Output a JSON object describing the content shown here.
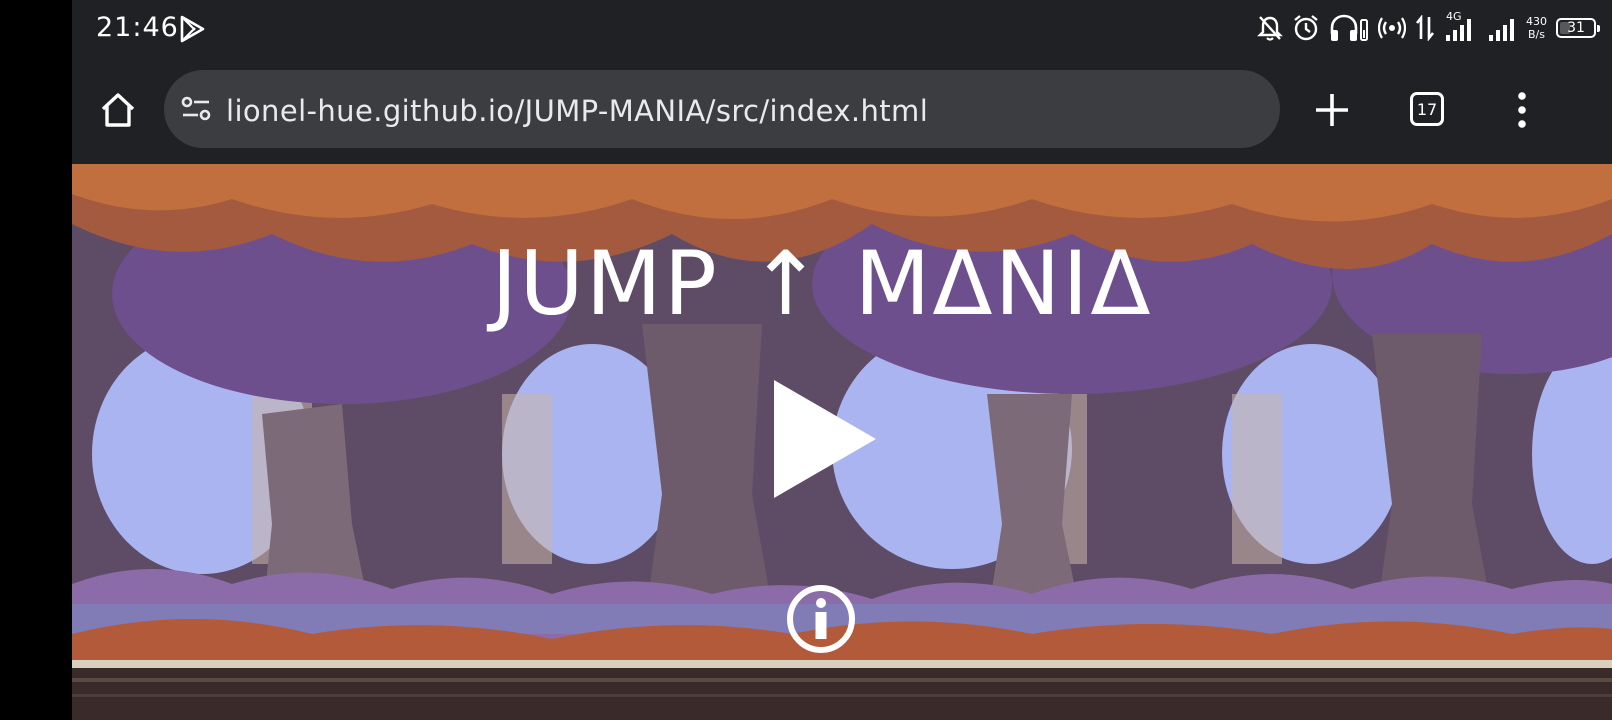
{
  "status_bar": {
    "time": "21:46",
    "net_speed_value": "430",
    "net_speed_unit": "B/s",
    "network_type": "4G",
    "battery_level": "31",
    "icons": [
      "play-store-icon",
      "notifications-muted-icon",
      "alarm-icon",
      "headset-icon",
      "hotspot-icon",
      "data-transfer-icon",
      "signal-icon",
      "signal-icon-2",
      "battery-icon"
    ]
  },
  "browser": {
    "url": "lionel-hue.github.io/JUMP-MANIA/src/index.html",
    "tab_count": "17",
    "icons": [
      "home-icon",
      "site-info-icon",
      "plus-icon",
      "tabs-icon",
      "more-vert-icon"
    ]
  },
  "game": {
    "title": "JUMP ↑ MΔNIΔ",
    "icons": [
      "play-icon",
      "info-icon"
    ]
  },
  "colors": {
    "chrome_bg": "#202124",
    "urlbar_bg": "#3c3d40",
    "sky": "#aab4f0",
    "foliage_orange": "#b25a3a",
    "foliage_purple": "#6e4f8e",
    "trunk": "#7d6a78",
    "ground": "#3b2a2a"
  }
}
